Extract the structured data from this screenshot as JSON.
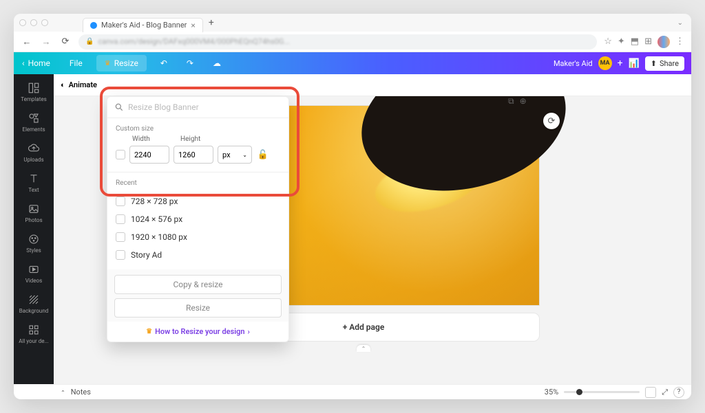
{
  "browser": {
    "tab_title": "Maker's Aid - Blog Banner",
    "url": "canva.com/design/DAFxq000VM4/000PhEQnQ74hs0G...",
    "new_tab": "+"
  },
  "topbar": {
    "home": "Home",
    "file": "File",
    "resize": "Resize",
    "brand": "Maker's Aid",
    "ma": "MA",
    "share": "Share"
  },
  "secondbar": {
    "animate": "Animate"
  },
  "sidebar": {
    "items": [
      {
        "label": "Templates"
      },
      {
        "label": "Elements"
      },
      {
        "label": "Uploads"
      },
      {
        "label": "Text"
      },
      {
        "label": "Photos"
      },
      {
        "label": "Styles"
      },
      {
        "label": "Videos"
      },
      {
        "label": "Background"
      },
      {
        "label": "All your de..."
      }
    ]
  },
  "resize": {
    "search_placeholder": "Resize Blog Banner",
    "custom_size": "Custom size",
    "width_label": "Width",
    "height_label": "Height",
    "width": "2240",
    "height": "1260",
    "unit": "px",
    "recent_label": "Recent",
    "recent": [
      "728 × 728 px",
      "1024 × 576 px",
      "1920 × 1080 px",
      "Story Ad"
    ],
    "copy_resize": "Copy & resize",
    "resize_btn": "Resize",
    "help": "How to Resize your design"
  },
  "canvas": {
    "add_page": "+ Add page"
  },
  "bottombar": {
    "notes": "Notes",
    "zoom": "35%"
  }
}
